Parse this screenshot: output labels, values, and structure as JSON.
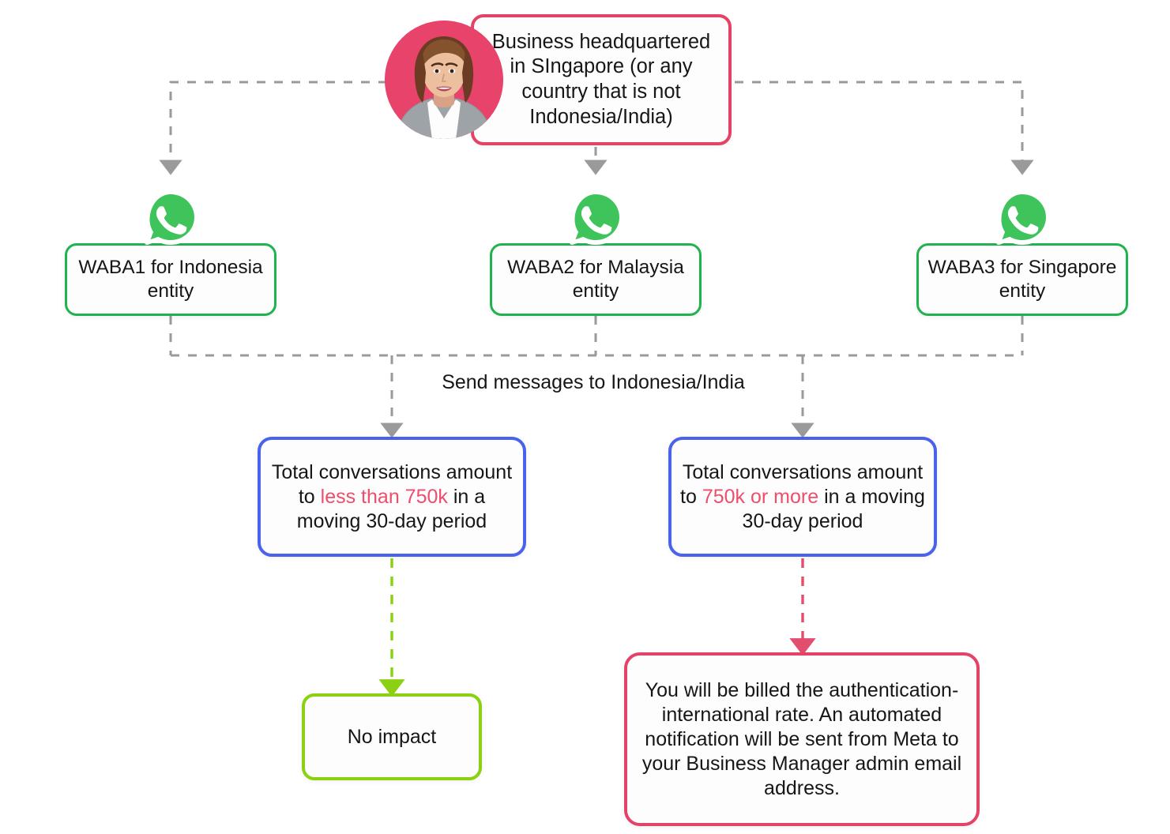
{
  "diagram": {
    "title_node": {
      "text": "Business headquartered in SIngapore (or any country that is not Indonesia/India)",
      "border_color": "#e54365"
    },
    "avatar": {
      "name": "business-owner-avatar",
      "background_color": "#e8436a"
    },
    "waba_nodes": [
      {
        "label": "WABA1 for Indonesia entity",
        "icon": "whatsapp-icon",
        "border_color": "#20b24f"
      },
      {
        "label": "WABA2 for Malaysia entity",
        "icon": "whatsapp-icon",
        "border_color": "#20b24f"
      },
      {
        "label": "WABA3 for Singapore entity",
        "icon": "whatsapp-icon",
        "border_color": "#20b24f"
      }
    ],
    "edge_label": "Send messages to Indonesia/India",
    "condition_nodes": [
      {
        "prefix": "Total conversations amount to ",
        "highlight": "less than 750k",
        "suffix": " in a moving 30-day period",
        "border_color": "#4a63ec",
        "highlight_color": "#ee4d6b"
      },
      {
        "prefix": "Total conversations amount to ",
        "highlight": "750k or more",
        "suffix": " in a moving 30-day period",
        "border_color": "#4a63ec",
        "highlight_color": "#ee4d6b"
      }
    ],
    "outcome_nodes": [
      {
        "label": "No impact",
        "border_color": "#8bd112",
        "connector_color": "#8bd112"
      },
      {
        "label": "You will be billed the authentication-international rate. An automated notification will be sent from Meta to your Business Manager admin email address.",
        "border_color": "#e54365",
        "connector_color": "#e14e6e"
      }
    ],
    "connector_color": "#9a9a9a"
  }
}
